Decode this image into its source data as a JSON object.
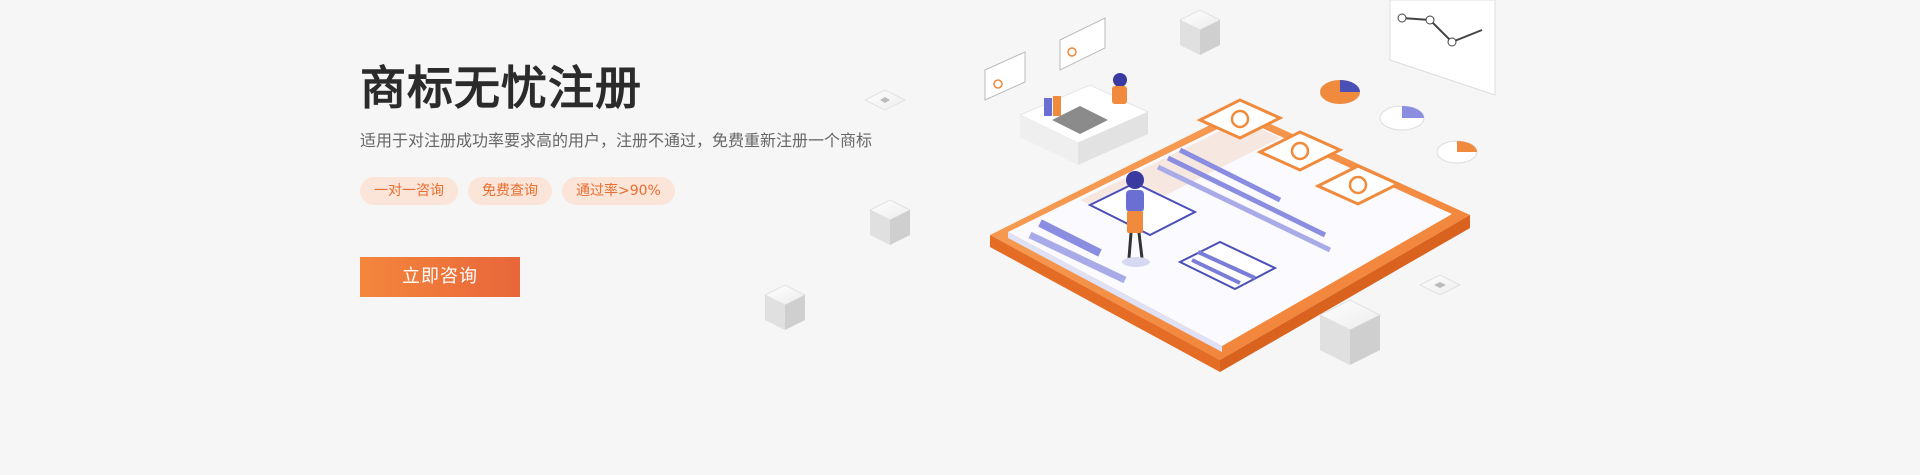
{
  "hero": {
    "title": "商标无忧注册",
    "subtitle": "适用于对注册成功率要求高的用户，注册不通过，免费重新注册一个商标",
    "tags": [
      "一对一咨询",
      "免费查询",
      "通过率>90%"
    ],
    "cta_label": "立即咨询"
  },
  "theme": {
    "accent": "#f08a3c",
    "tag_bg": "#fbe4d8",
    "tag_text": "#e86f2f",
    "title_color": "#2b2b2b",
    "illustration_purple": "#6b6fd4"
  },
  "illustration": {
    "icons": [
      "phone-icon",
      "trademark-r-icon",
      "person-icon",
      "pie-chart-icon",
      "line-chart-icon",
      "cube-icon",
      "message-bubble-icon"
    ]
  }
}
